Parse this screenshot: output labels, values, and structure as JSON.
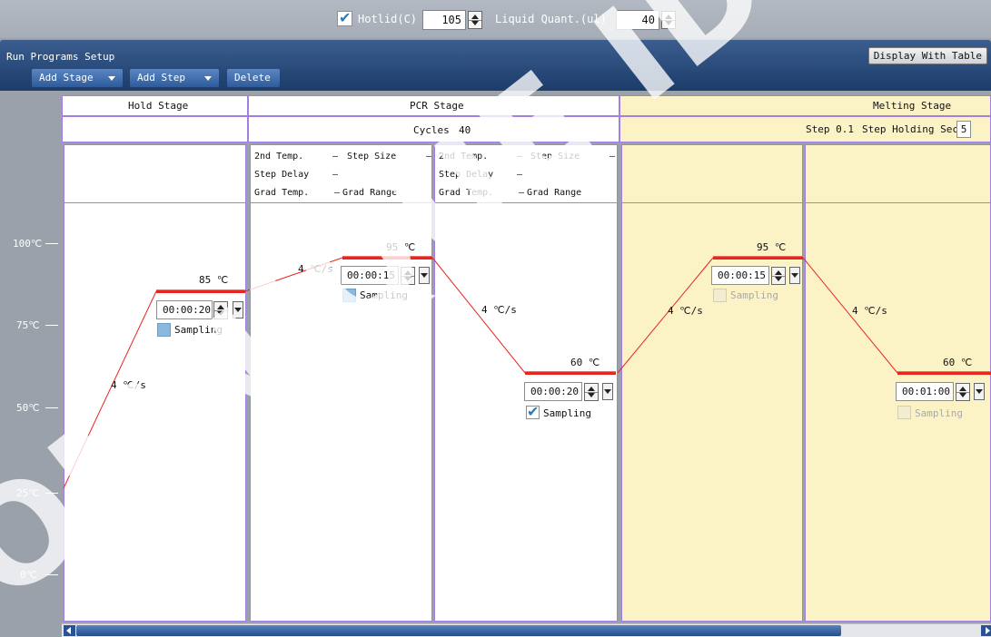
{
  "topbar": {
    "hotlid_checked": true,
    "hotlid_label": "Hotlid(C)",
    "hotlid_value": "105",
    "liquid_label": "Liquid Quant.(ul)",
    "liquid_value": "40"
  },
  "header": {
    "title": "Run Programs Setup",
    "add_stage": "Add Stage",
    "add_step": "Add Step",
    "delete": "Delete",
    "display_with_table": "Display With Table"
  },
  "y_axis": [
    "100℃",
    "75℃",
    "50℃",
    "25℃",
    "0℃"
  ],
  "stages": {
    "hold": {
      "name": "Hold Stage"
    },
    "pcr": {
      "name": "PCR Stage",
      "cycles_label": "Cycles",
      "cycles_value": "40"
    },
    "melting": {
      "name": "Melting Stage",
      "step_label": "Step 0.1",
      "holding_label": "Step Holding Sec.",
      "holding_value": "5"
    }
  },
  "pcr_params": {
    "second_temp": "2nd Temp.",
    "step_size": "Step Size",
    "step_delay": "Step Delay",
    "grad_temp": "Grad Temp.",
    "grad_range": "Grad Range",
    "dash": "–"
  },
  "steps": [
    {
      "temp": "85 ℃",
      "temp_value": 85,
      "time": "00:00:20",
      "rate": "4 ℃/s",
      "sampling": "Sampling",
      "sampling_state": "unchecked"
    },
    {
      "temp": "95 ℃",
      "temp_value": 95,
      "time": "00:00:15",
      "rate": "4 ℃/s",
      "sampling": "Sampling",
      "sampling_state": "unchecked"
    },
    {
      "temp": "60 ℃",
      "temp_value": 60,
      "time": "00:00:20",
      "rate": "4 ℃/s",
      "sampling": "Sampling",
      "sampling_state": "checked"
    },
    {
      "temp": "95 ℃",
      "temp_value": 95,
      "time": "00:00:15",
      "rate": "4 ℃/s",
      "sampling": "Sampling",
      "sampling_state": "disabled"
    },
    {
      "temp": "60 ℃",
      "temp_value": 60,
      "time": "00:01:00",
      "rate": "4 ℃/s",
      "sampling": "Sampling",
      "sampling_state": "disabled"
    }
  ],
  "watermark": "OMNIQUE ID",
  "colors": {
    "header": "#1c3c6a",
    "accent": "#e8261e",
    "border": "#a27fe0",
    "melting_bg": "#fbf2c6"
  }
}
